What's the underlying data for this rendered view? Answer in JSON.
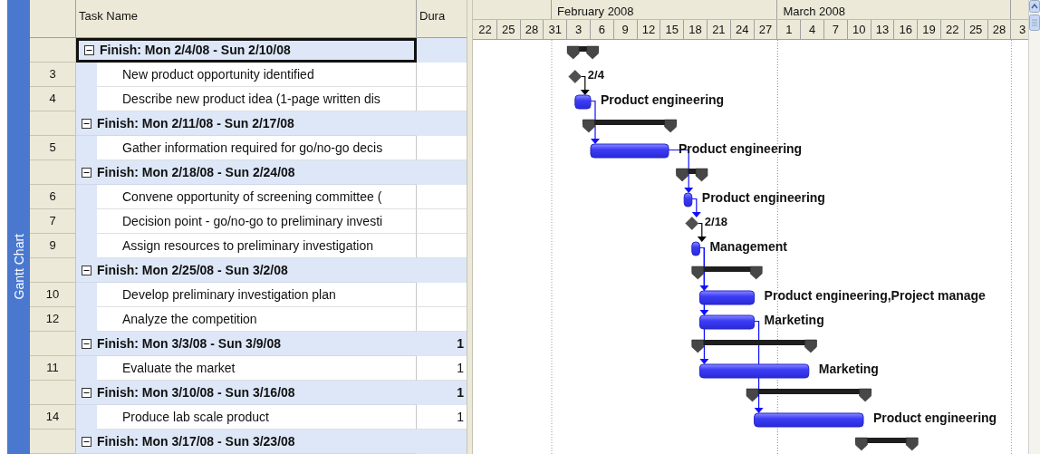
{
  "view_bar": {
    "label": "Gantt Chart"
  },
  "table": {
    "columns": [
      "Task Name",
      "Dura"
    ],
    "rows": [
      {
        "kind": "group",
        "name": "Finish: Mon 2/4/08 - Sun 2/10/08",
        "expanded": true,
        "selected": true,
        "bar": {
          "kind": "summary"
        }
      },
      {
        "kind": "task",
        "id": "3",
        "name": "New product opportunity identified",
        "selected": false,
        "bar": {
          "kind": "milestone",
          "label": "2/4"
        }
      },
      {
        "kind": "task",
        "id": "4",
        "name": "Describe new product idea (1-page written dis",
        "selected": false,
        "bar": {
          "kind": "task",
          "label": "Product engineering"
        }
      },
      {
        "kind": "group",
        "name": "Finish: Mon 2/11/08 - Sun 2/17/08",
        "expanded": true,
        "selected": false,
        "bar": {
          "kind": "summary"
        }
      },
      {
        "kind": "task",
        "id": "5",
        "name": "Gather information required for go/no-go decis",
        "selected": false,
        "bar": {
          "kind": "task",
          "label": "Product engineering"
        }
      },
      {
        "kind": "group",
        "name": "Finish: Mon 2/18/08 - Sun 2/24/08",
        "expanded": true,
        "selected": false,
        "bar": {
          "kind": "summary"
        }
      },
      {
        "kind": "task",
        "id": "6",
        "name": "Convene opportunity of screening committee (",
        "selected": false,
        "bar": {
          "kind": "task",
          "label": "Product engineering"
        }
      },
      {
        "kind": "task",
        "id": "7",
        "name": "Decision point - go/no-go to preliminary investi",
        "selected": false,
        "bar": {
          "kind": "milestone",
          "label": "2/18"
        }
      },
      {
        "kind": "task",
        "id": "9",
        "name": "Assign resources to preliminary investigation",
        "selected": false,
        "bar": {
          "kind": "task",
          "label": "Management"
        }
      },
      {
        "kind": "group",
        "name": "Finish: Mon 2/25/08 - Sun 3/2/08",
        "expanded": true,
        "selected": false,
        "bar": {
          "kind": "summary"
        }
      },
      {
        "kind": "task",
        "id": "10",
        "name": "Develop preliminary investigation plan",
        "selected": false,
        "bar": {
          "kind": "task",
          "label": "Product engineering,Project manage"
        }
      },
      {
        "kind": "task",
        "id": "12",
        "name": "Analyze the competition",
        "selected": false,
        "bar": {
          "kind": "task",
          "label": "Marketing"
        }
      },
      {
        "kind": "group",
        "name": "Finish: Mon 3/3/08 - Sun 3/9/08",
        "duration": "1",
        "expanded": true,
        "selected": false,
        "bar": {
          "kind": "summary"
        }
      },
      {
        "kind": "task",
        "id": "11",
        "name": "Evaluate the market",
        "duration": "1",
        "selected": false,
        "bar": {
          "kind": "task",
          "label": "Marketing"
        }
      },
      {
        "kind": "group",
        "name": "Finish: Mon 3/10/08 - Sun 3/16/08",
        "duration": "1",
        "expanded": true,
        "selected": false,
        "bar": {
          "kind": "summary"
        }
      },
      {
        "kind": "task",
        "id": "14",
        "name": "Produce lab scale product",
        "duration": "1",
        "selected": false,
        "bar": {
          "kind": "task",
          "label": "Product engineering"
        }
      },
      {
        "kind": "group",
        "name": "Finish: Mon 3/17/08 - Sun 3/23/08",
        "expanded": true,
        "selected": false,
        "bar": {
          "kind": "summary"
        }
      }
    ]
  },
  "timescale": {
    "months": [
      "February 2008",
      "March 2008"
    ],
    "days": [
      "22",
      "25",
      "28",
      "31",
      "3",
      "6",
      "9",
      "12",
      "15",
      "18",
      "21",
      "24",
      "27",
      "1",
      "4",
      "7",
      "10",
      "13",
      "16",
      "19",
      "22",
      "25",
      "28",
      "3"
    ]
  }
}
